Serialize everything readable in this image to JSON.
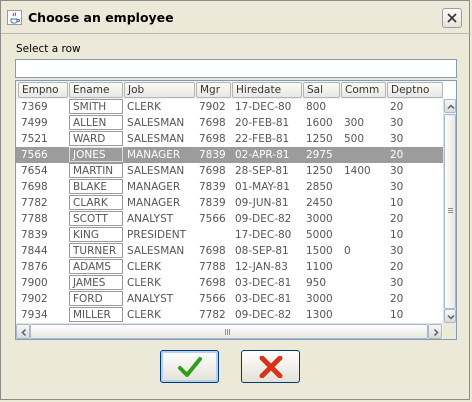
{
  "window": {
    "title": "Choose an employee"
  },
  "prompt": "Select a row",
  "search": {
    "value": ""
  },
  "table": {
    "columns": [
      "Empno",
      "Ename",
      "Job",
      "Mgr",
      "Hiredate",
      "Sal",
      "Comm",
      "Deptno"
    ],
    "selected_row": 3,
    "rows": [
      [
        "7369",
        "SMITH",
        "CLERK",
        "7902",
        "17-DEC-80",
        "800",
        "",
        "20"
      ],
      [
        "7499",
        "ALLEN",
        "SALESMAN",
        "7698",
        "20-FEB-81",
        "1600",
        "300",
        "30"
      ],
      [
        "7521",
        "WARD",
        "SALESMAN",
        "7698",
        "22-FEB-81",
        "1250",
        "500",
        "30"
      ],
      [
        "7566",
        "JONES",
        "MANAGER",
        "7839",
        "02-APR-81",
        "2975",
        "",
        "20"
      ],
      [
        "7654",
        "MARTIN",
        "SALESMAN",
        "7698",
        "28-SEP-81",
        "1250",
        "1400",
        "30"
      ],
      [
        "7698",
        "BLAKE",
        "MANAGER",
        "7839",
        "01-MAY-81",
        "2850",
        "",
        "30"
      ],
      [
        "7782",
        "CLARK",
        "MANAGER",
        "7839",
        "09-JUN-81",
        "2450",
        "",
        "10"
      ],
      [
        "7788",
        "SCOTT",
        "ANALYST",
        "7566",
        "09-DEC-82",
        "3000",
        "",
        "20"
      ],
      [
        "7839",
        "KING",
        "PRESIDENT",
        "",
        "17-DEC-80",
        "5000",
        "",
        "10"
      ],
      [
        "7844",
        "TURNER",
        "SALESMAN",
        "7698",
        "08-SEP-81",
        "1500",
        "0",
        "30"
      ],
      [
        "7876",
        "ADAMS",
        "CLERK",
        "7788",
        "12-JAN-83",
        "1100",
        "",
        "20"
      ],
      [
        "7900",
        "JAMES",
        "CLERK",
        "7698",
        "03-DEC-81",
        "950",
        "",
        "30"
      ],
      [
        "7902",
        "FORD",
        "ANALYST",
        "7566",
        "03-DEC-81",
        "3000",
        "",
        "20"
      ],
      [
        "7934",
        "MILLER",
        "CLERK",
        "7782",
        "09-DEC-82",
        "1300",
        "",
        "10"
      ]
    ]
  },
  "buttons": {
    "ok_icon": "check-icon",
    "cancel_icon": "x-icon"
  },
  "colors": {
    "selection": "#9c9c9c",
    "ok": "#2f9e1f",
    "cancel": "#d8321a"
  }
}
